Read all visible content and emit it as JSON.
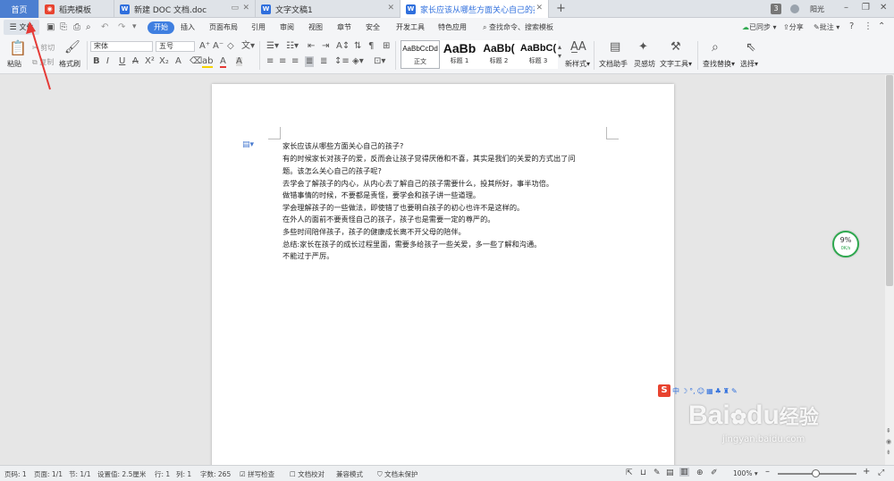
{
  "tabs": {
    "home": "首页",
    "t1": "稻壳模板",
    "t2": "新建 DOC 文档.doc",
    "t3": "文字文稿1",
    "t4": "家长应该从哪些方面关心自己的孩",
    "badge": "3",
    "user": "阳光"
  },
  "menu": {
    "file": "文件",
    "start": "开始",
    "insert": "插入",
    "layout": "页面布局",
    "ref": "引用",
    "review": "审阅",
    "view": "视图",
    "chapter": "章节",
    "security": "安全",
    "dev": "开发工具",
    "special": "特色应用",
    "search": "查找命令、搜索模板",
    "sync": "已同步",
    "share": "分享",
    "comment": "批注"
  },
  "ribbon": {
    "paste": "粘贴",
    "cut": "剪切",
    "copy": "复制",
    "painter": "格式刷",
    "font": "宋体",
    "size": "五号",
    "style_preview1": "AaBbCcDd",
    "style_preview2": "AaBb",
    "style_preview3": "AaBb(",
    "style_preview4": "AaBbC(",
    "style1": "正文",
    "style2": "标题 1",
    "style3": "标题 2",
    "style4": "标题 3",
    "newstyle": "新样式",
    "assistant": "文档助手",
    "inspire": "灵感坊",
    "texttool": "文字工具",
    "findreplace": "查找替换",
    "select": "选择"
  },
  "document": {
    "lines": [
      "家长应该从哪些方面关心自己的孩子?",
      "有的时候家长对孩子的爱，反而会让孩子觉得厌倦和不喜，其实是我们的关爱的方式出了问",
      "题。该怎么关心自己的孩子呢?",
      "去学会了解孩子的内心，从内心去了解自己的孩子需要什么，投其所好，事半功倍。",
      "做错事情的时候，不要都是责怪，要学会和孩子讲一些道理。",
      "学会理解孩子的一些做法，即使错了也要明白孩子的初心也许不是这样的。",
      "在外人的面前不要责怪自己的孩子，孩子也是需要一定的尊严的。",
      "多些时间陪伴孩子，孩子的健康成长离不开父母的陪伴。",
      "总结:家长在孩子的成长过程里面，需要多给孩子一些关爱，多一些了解和沟通。",
      "不能过于严厉。"
    ]
  },
  "widget": {
    "percent": "9%",
    "speed": "0K/s"
  },
  "ime": {
    "logo": "S",
    "lang": "中"
  },
  "watermark": {
    "brand1": "Bai",
    "brand2": "du",
    "jingyan": "经验",
    "url": "jingyan.baidu.com"
  },
  "status": {
    "page": "页码: 1",
    "pages": "页面: 1/1",
    "section": "节: 1/1",
    "setting": "设置值: 2.5厘米",
    "row": "行: 1",
    "col": "列: 1",
    "words": "字数: 265",
    "spell": "拼写检查",
    "proof": "文档校对",
    "compat": "兼容模式",
    "protect": "文档未保护",
    "zoom": "100%"
  },
  "colors": {
    "accent": "#3f7fe0",
    "annotation": "#e53935"
  }
}
